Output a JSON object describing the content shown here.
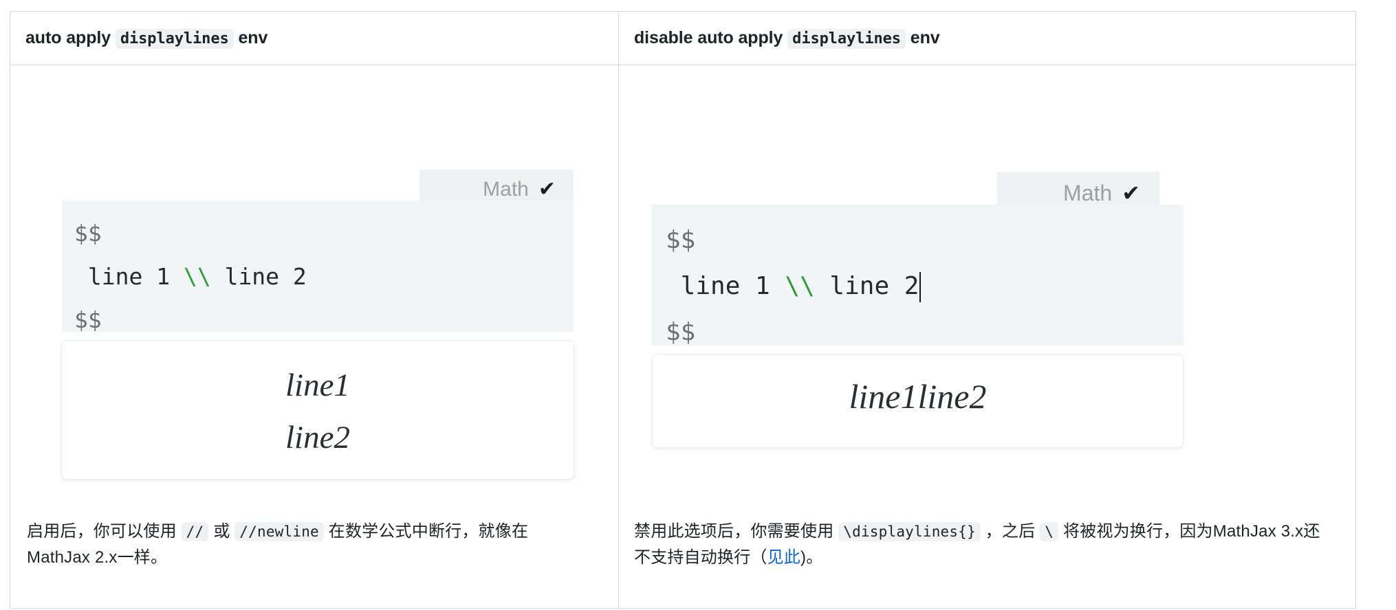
{
  "table": {
    "columns": [
      {
        "header": {
          "pre": "auto apply",
          "code": "displaylines",
          "post": "env"
        },
        "screenshot": {
          "badge_label": "Math",
          "badge_check": "✔",
          "code": {
            "line1": "$$",
            "line2_pre": " line 1 ",
            "line2_slashes": "\\\\",
            "line2_post": " line 2",
            "line3": "$$",
            "cursor_visible": false
          },
          "rendered_math": [
            "line1",
            "line2"
          ]
        },
        "caption": {
          "t1": "启用后，你可以使用 ",
          "c1": "//",
          "t2": " 或 ",
          "c2": "//newline",
          "t3": " 在数学公式中断行，就像在MathJax 2.x一样。"
        }
      },
      {
        "header": {
          "pre": "disable auto apply",
          "code": "displaylines",
          "post": "env"
        },
        "screenshot": {
          "badge_label": "Math",
          "badge_check": "✔",
          "code": {
            "line1": "$$",
            "line2_pre": " line 1 ",
            "line2_slashes": "\\\\",
            "line2_post": " line 2",
            "line3": "$$",
            "cursor_visible": true
          },
          "rendered_math": [
            "line1line2"
          ]
        },
        "caption": {
          "t1": "禁用此选项后，你需要使用 ",
          "c1": "\\displaylines{}",
          "t2": " ，之后 ",
          "c2": "\\",
          "t3": " 将被视为换行，因为MathJax 3.x还不支持自动换行（",
          "link": "见此",
          "t4": ")。"
        }
      }
    ]
  },
  "colors": {
    "border": "#d0d7de",
    "code_bg": "#f1f5f5",
    "badge_bg": "#eef2f3",
    "inline_code_bg": "#eff1f3",
    "backslash_green": "#2f9d3c",
    "link_blue": "#0969da",
    "text": "#1f2328"
  }
}
